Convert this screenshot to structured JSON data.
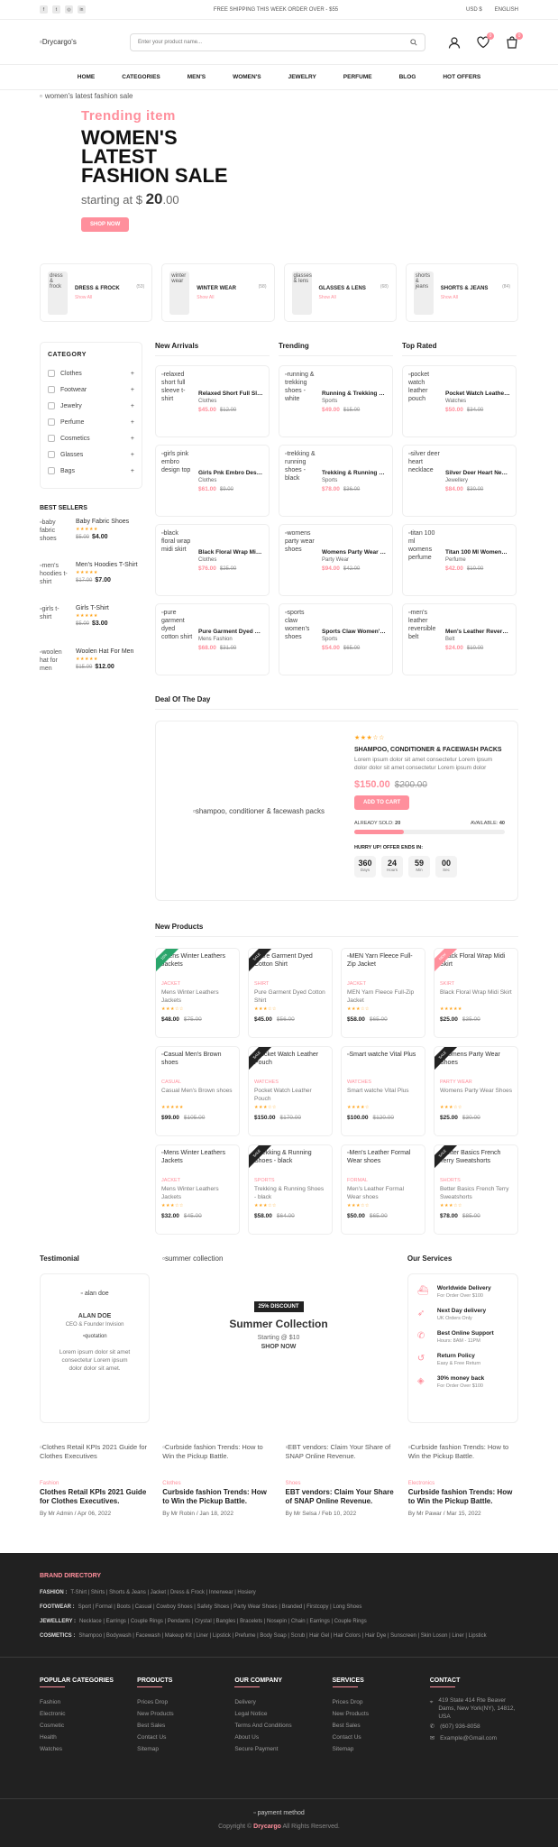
{
  "topbar": {
    "social_icons": [
      "facebook-icon",
      "twitter-icon",
      "instagram-icon",
      "linkedin-icon"
    ],
    "shipping_notice": "FREE SHIPPING THIS WEEK ORDER OVER - $55",
    "currency": "USD $",
    "language": "ENGLISH"
  },
  "header": {
    "logo_alt": "Drycargo's",
    "search_placeholder": "Enter your product name...",
    "wishlist_count": "0",
    "cart_count": "0"
  },
  "nav": [
    "HOME",
    "CATEGORIES",
    "MEN'S",
    "WOMEN'S",
    "JEWELRY",
    "PERFUME",
    "BLOG",
    "HOT OFFERS"
  ],
  "hero": {
    "image_alt": "women's latest fashion sale",
    "subtitle": "Trending item",
    "title_line1": "WOMEN'S",
    "title_line2": "LATEST",
    "title_line3": "FASHION SALE",
    "starting_text": "starting at $",
    "price_int": "20",
    "price_dec": ".00",
    "button": "SHOP NOW"
  },
  "categories": [
    {
      "img_alt": "dress & frock",
      "name": "DRESS & FROCK",
      "count": "(53)",
      "link": "Show All"
    },
    {
      "img_alt": "winter wear",
      "name": "WINTER WEAR",
      "count": "(58)",
      "link": "Show All"
    },
    {
      "img_alt": "glasses & lens",
      "name": "GLASSES & LENS",
      "count": "(68)",
      "link": "Show All"
    },
    {
      "img_alt": "shorts & jeans",
      "name": "SHORTS & JEANS",
      "count": "(84)",
      "link": "Show All"
    }
  ],
  "sidebar": {
    "title": "CATEGORY",
    "items": [
      "Clothes",
      "Footwear",
      "Jewelry",
      "Perfume",
      "Cosmetics",
      "Glasses",
      "Bags"
    ],
    "best_title": "BEST SELLERS",
    "best": [
      {
        "img": "baby fabric shoes",
        "name": "Baby Fabric Shoes",
        "old": "$5.00",
        "price": "$4.00"
      },
      {
        "img": "men's hoodies t-shirt",
        "name": "Men's Hoodies T-Shirt",
        "old": "$17.00",
        "price": "$7.00"
      },
      {
        "img": "girls t-shirt",
        "name": "Girls T-Shirt",
        "old": "$5.00",
        "price": "$3.00"
      },
      {
        "img": "woolen hat for men",
        "name": "Woolen Hat For Men",
        "old": "$15.00",
        "price": "$12.00"
      }
    ]
  },
  "new_arrivals": {
    "title": "New Arrivals",
    "items": [
      {
        "img": "relaxed short full sleeve t-shirt",
        "name": "Relaxed Short Full Sleeve T-Shirt",
        "cat": "Clothes",
        "price": "$45.00",
        "old": "$12.00"
      },
      {
        "img": "girls pink embro design top",
        "name": "Girls Pnk Embro Design Top",
        "cat": "Clothes",
        "price": "$61.00",
        "old": "$9.00"
      },
      {
        "img": "black floral wrap midi skirt",
        "name": "Black Floral Wrap Midi Skirt",
        "cat": "Clothes",
        "price": "$76.00",
        "old": "$25.00"
      },
      {
        "img": "pure garment dyed cotton shirt",
        "name": "Pure Garment Dyed Cotton Shirt",
        "cat": "Mens Fashion",
        "price": "$68.00",
        "old": "$31.00"
      }
    ]
  },
  "trending": {
    "title": "Trending",
    "items": [
      {
        "img": "running & trekking shoes - white",
        "name": "Running & Trekking Shoes - White",
        "cat": "Sports",
        "price": "$49.00",
        "old": "$15.00"
      },
      {
        "img": "trekking & running shoes - black",
        "name": "Trekking & Running Shoes - black",
        "cat": "Sports",
        "price": "$78.00",
        "old": "$36.00"
      },
      {
        "img": "womens party wear shoes",
        "name": "Womens Party Wear Shoes",
        "cat": "Party Wear",
        "price": "$94.00",
        "old": "$42.00"
      },
      {
        "img": "sports claw women's shoes",
        "name": "Sports Claw Women's Shoes",
        "cat": "Sports",
        "price": "$54.00",
        "old": "$65.00"
      }
    ]
  },
  "top_rated": {
    "title": "Top Rated",
    "items": [
      {
        "img": "pocket watch leather pouch",
        "name": "Pocket Watch Leather Pouch",
        "cat": "Watches",
        "price": "$50.00",
        "old": "$34.00"
      },
      {
        "img": "silver deer heart necklace",
        "name": "Silver Deer Heart Necklace",
        "cat": "Jewellery",
        "price": "$84.00",
        "old": "$30.00"
      },
      {
        "img": "titan 100 ml womens perfume",
        "name": "Titan 100 Ml Womens Perfume",
        "cat": "Perfume",
        "price": "$42.00",
        "old": "$10.00"
      },
      {
        "img": "men's leather reversible belt",
        "name": "Men's Leather Reversible Belt",
        "cat": "Belt",
        "price": "$24.00",
        "old": "$10.00"
      }
    ]
  },
  "deal": {
    "title": "Deal Of The Day",
    "img_alt": "shampoo, conditioner & facewash packs",
    "stars": "★★★☆☆",
    "name": "SHAMPOO, CONDITIONER & FACEWASH PACKS",
    "desc": "Lorem ipsum dolor sit amet consectetur Lorem ipsum dolor dolor sit amet consectetur Lorem ipsum dolor",
    "price": "$150.00",
    "old": "$200.00",
    "button": "ADD TO CART",
    "sold_label": "ALREADY SOLD:",
    "sold": "20",
    "available_label": "AVAILABLE:",
    "available": "40",
    "sold_fraction": 0.33,
    "hurry": "HURRY UP! OFFER ENDS IN:",
    "timer": [
      {
        "v": "360",
        "u": "Days"
      },
      {
        "v": "24",
        "u": "Hours"
      },
      {
        "v": "59",
        "u": "Min"
      },
      {
        "v": "00",
        "u": "Sec"
      }
    ]
  },
  "new_products": {
    "title": "New Products",
    "items": [
      {
        "img": "Mens Winter Leathers Jackets",
        "cat": "JACKET",
        "name": "Mens Winter Leathers Jackets",
        "stars": "★★★☆☆",
        "price": "$48.00",
        "old": "$75.00",
        "ribbon": "15%",
        "ribbon_color": "green"
      },
      {
        "img": "Pure Garment Dyed Cotton Shirt",
        "cat": "SHIRT",
        "name": "Pure Garment Dyed Cotton Shirt",
        "stars": "★★★☆☆",
        "price": "$45.00",
        "old": "$56.00",
        "ribbon": "SALE",
        "ribbon_color": "black"
      },
      {
        "img": "MEN Yarn Fleece Full-Zip Jacket",
        "cat": "JACKET",
        "name": "MEN Yarn Fleece Full-Zip Jacket",
        "stars": "★★★☆☆",
        "price": "$58.00",
        "old": "$65.00",
        "ribbon": "",
        "ribbon_color": ""
      },
      {
        "img": "Black Floral Wrap Midi Skirt",
        "cat": "SKIRT",
        "name": "Black Floral Wrap Midi Skirt",
        "stars": "★★★★★",
        "price": "$25.00",
        "old": "$35.00",
        "ribbon": "NEW",
        "ribbon_color": "pink"
      },
      {
        "img": "Casual Men's Brown shoes",
        "cat": "CASUAL",
        "name": "Casual Men's Brown shoes",
        "stars": "★★★★★",
        "price": "$99.00",
        "old": "$105.00",
        "ribbon": "",
        "ribbon_color": ""
      },
      {
        "img": "Pocket Watch Leather Pouch",
        "cat": "WATCHES",
        "name": "Pocket Watch Leather Pouch",
        "stars": "★★★☆☆",
        "price": "$150.00",
        "old": "$170.00",
        "ribbon": "SALE",
        "ribbon_color": "black"
      },
      {
        "img": "Smart watche Vital Plus",
        "cat": "WATCHES",
        "name": "Smart watche Vital Plus",
        "stars": "★★★★☆",
        "price": "$100.00",
        "old": "$120.00",
        "ribbon": "",
        "ribbon_color": ""
      },
      {
        "img": "Womens Party Wear Shoes",
        "cat": "PARTY WEAR",
        "name": "Womens Party Wear Shoes",
        "stars": "★★★☆☆",
        "price": "$25.00",
        "old": "$30.00",
        "ribbon": "SALE",
        "ribbon_color": "black"
      },
      {
        "img": "Mens Winter Leathers Jackets",
        "cat": "JACKET",
        "name": "Mens Winter Leathers Jackets",
        "stars": "★★★☆☆",
        "price": "$32.00",
        "old": "$45.00",
        "ribbon": "",
        "ribbon_color": ""
      },
      {
        "img": "Trekking & Running Shoes - black",
        "cat": "SPORTS",
        "name": "Trekking & Running Shoes - black",
        "stars": "★★★☆☆",
        "price": "$58.00",
        "old": "$64.00",
        "ribbon": "SALE",
        "ribbon_color": "black"
      },
      {
        "img": "Men's Leather Formal Wear shoes",
        "cat": "FORMAL",
        "name": "Men's Leather Formal Wear shoes",
        "stars": "★★★☆☆",
        "price": "$50.00",
        "old": "$65.00",
        "ribbon": "",
        "ribbon_color": ""
      },
      {
        "img": "Better Basics French Terry Sweatshorts",
        "cat": "SHORTS",
        "name": "Better Basics French Terry Sweatshorts",
        "stars": "★★★☆☆",
        "price": "$78.00",
        "old": "$85.00",
        "ribbon": "SALE",
        "ribbon_color": "black"
      }
    ]
  },
  "testimonial": {
    "title": "Testimonial",
    "img_alt": "alan doe",
    "name": "ALAN DOE",
    "role": "CEO & Founder Invision",
    "quote_alt": "quotation",
    "body": "Lorem ipsum dolor sit amet consectetur Lorem ipsum dolor dolor sit amet."
  },
  "cta": {
    "img_alt": "summer collection",
    "discount": "25% DISCOUNT",
    "title": "Summer Collection",
    "starting": "Starting @ $10",
    "link": "SHOP NOW"
  },
  "services": {
    "title": "Our Services",
    "items": [
      {
        "icon": "boat-icon",
        "title": "Worldwide Delivery",
        "sub": "For Order Over $100"
      },
      {
        "icon": "rocket-icon",
        "title": "Next Day delivery",
        "sub": "UK Orders Only"
      },
      {
        "icon": "call-icon",
        "title": "Best Online Support",
        "sub": "Hours: 8AM - 11PM"
      },
      {
        "icon": "return-icon",
        "title": "Return Policy",
        "sub": "Easy & Free Return"
      },
      {
        "icon": "ticket-icon",
        "title": "30% money back",
        "sub": "For Order Over $100"
      }
    ]
  },
  "blog": [
    {
      "img": "Clothes Retail KPIs 2021 Guide for Clothes Executives",
      "cat": "Fashion",
      "title": "Clothes Retail KPIs 2021 Guide for Clothes Executives.",
      "by": "By Mr Admin / Apr 06, 2022"
    },
    {
      "img": "Curbside fashion Trends: How to Win the Pickup Battle.",
      "cat": "Clothes",
      "title": "Curbside fashion Trends: How to Win the Pickup Battle.",
      "by": "By Mr Robin / Jan 18, 2022"
    },
    {
      "img": "EBT vendors: Claim Your Share of SNAP Online Revenue.",
      "cat": "Shoes",
      "title": "EBT vendors: Claim Your Share of SNAP Online Revenue.",
      "by": "By Mr Selsa / Feb 10, 2022"
    },
    {
      "img": "Curbside fashion Trends: How to Win the Pickup Battle.",
      "cat": "Electronics",
      "title": "Curbside fashion Trends: How to Win the Pickup Battle.",
      "by": "By Mr Pawar / Mar 15, 2022"
    }
  ],
  "footer": {
    "brand_title": "BRAND DIRECTORY",
    "rows": [
      {
        "label": "FASHION :",
        "items": "T-Shirt | Shirts | Shorts & Jeans | Jacket | Dress & Frock | Innerwear | Hosiery"
      },
      {
        "label": "FOOTWEAR :",
        "items": "Sport | Formal | Boots | Casual | Cowboy Shoes | Safety Shoes | Party Wear Shoes | Branded | Firstcopy | Long Shoes"
      },
      {
        "label": "JEWELLERY :",
        "items": "Necklace | Earrings | Couple Rings | Pendants | Crystal | Bangles | Bracelets | Nosepin | Chain | Earrings | Couple Rings"
      },
      {
        "label": "COSMETICS :",
        "items": "Shampoo | Bodywash | Facewash | Makeup Kit | Liner | Lipstick | Prefume | Body Soap | Scrub | Hair Gel | Hair Colors | Hair Dye | Sunscreen | Skin Loson | Liner | Lipstick"
      }
    ],
    "cols": [
      {
        "title": "POPULAR CATEGORIES",
        "items": [
          "Fashion",
          "Electronic",
          "Cosmetic",
          "Health",
          "Watches"
        ]
      },
      {
        "title": "PRODUCTS",
        "items": [
          "Prices Drop",
          "New Products",
          "Best Sales",
          "Contact Us",
          "Sitemap"
        ]
      },
      {
        "title": "OUR COMPANY",
        "items": [
          "Delivery",
          "Legal Notice",
          "Terms And Conditions",
          "About Us",
          "Secure Payment"
        ]
      },
      {
        "title": "SERVICES",
        "items": [
          "Prices Drop",
          "New Products",
          "Best Sales",
          "Contact Us",
          "Sitemap"
        ]
      }
    ],
    "contact_title": "CONTACT",
    "contact": [
      "419 State 414 Rte Beaver Dams, New York(NY), 14812, USA",
      "(607) 936-8058",
      "Example@Gmail.com"
    ],
    "payment_alt": "payment method",
    "copyright_pre": "Copyright ©",
    "copyright_brand": "Drycargo",
    "copyright_post": "All Rights Reserved."
  }
}
